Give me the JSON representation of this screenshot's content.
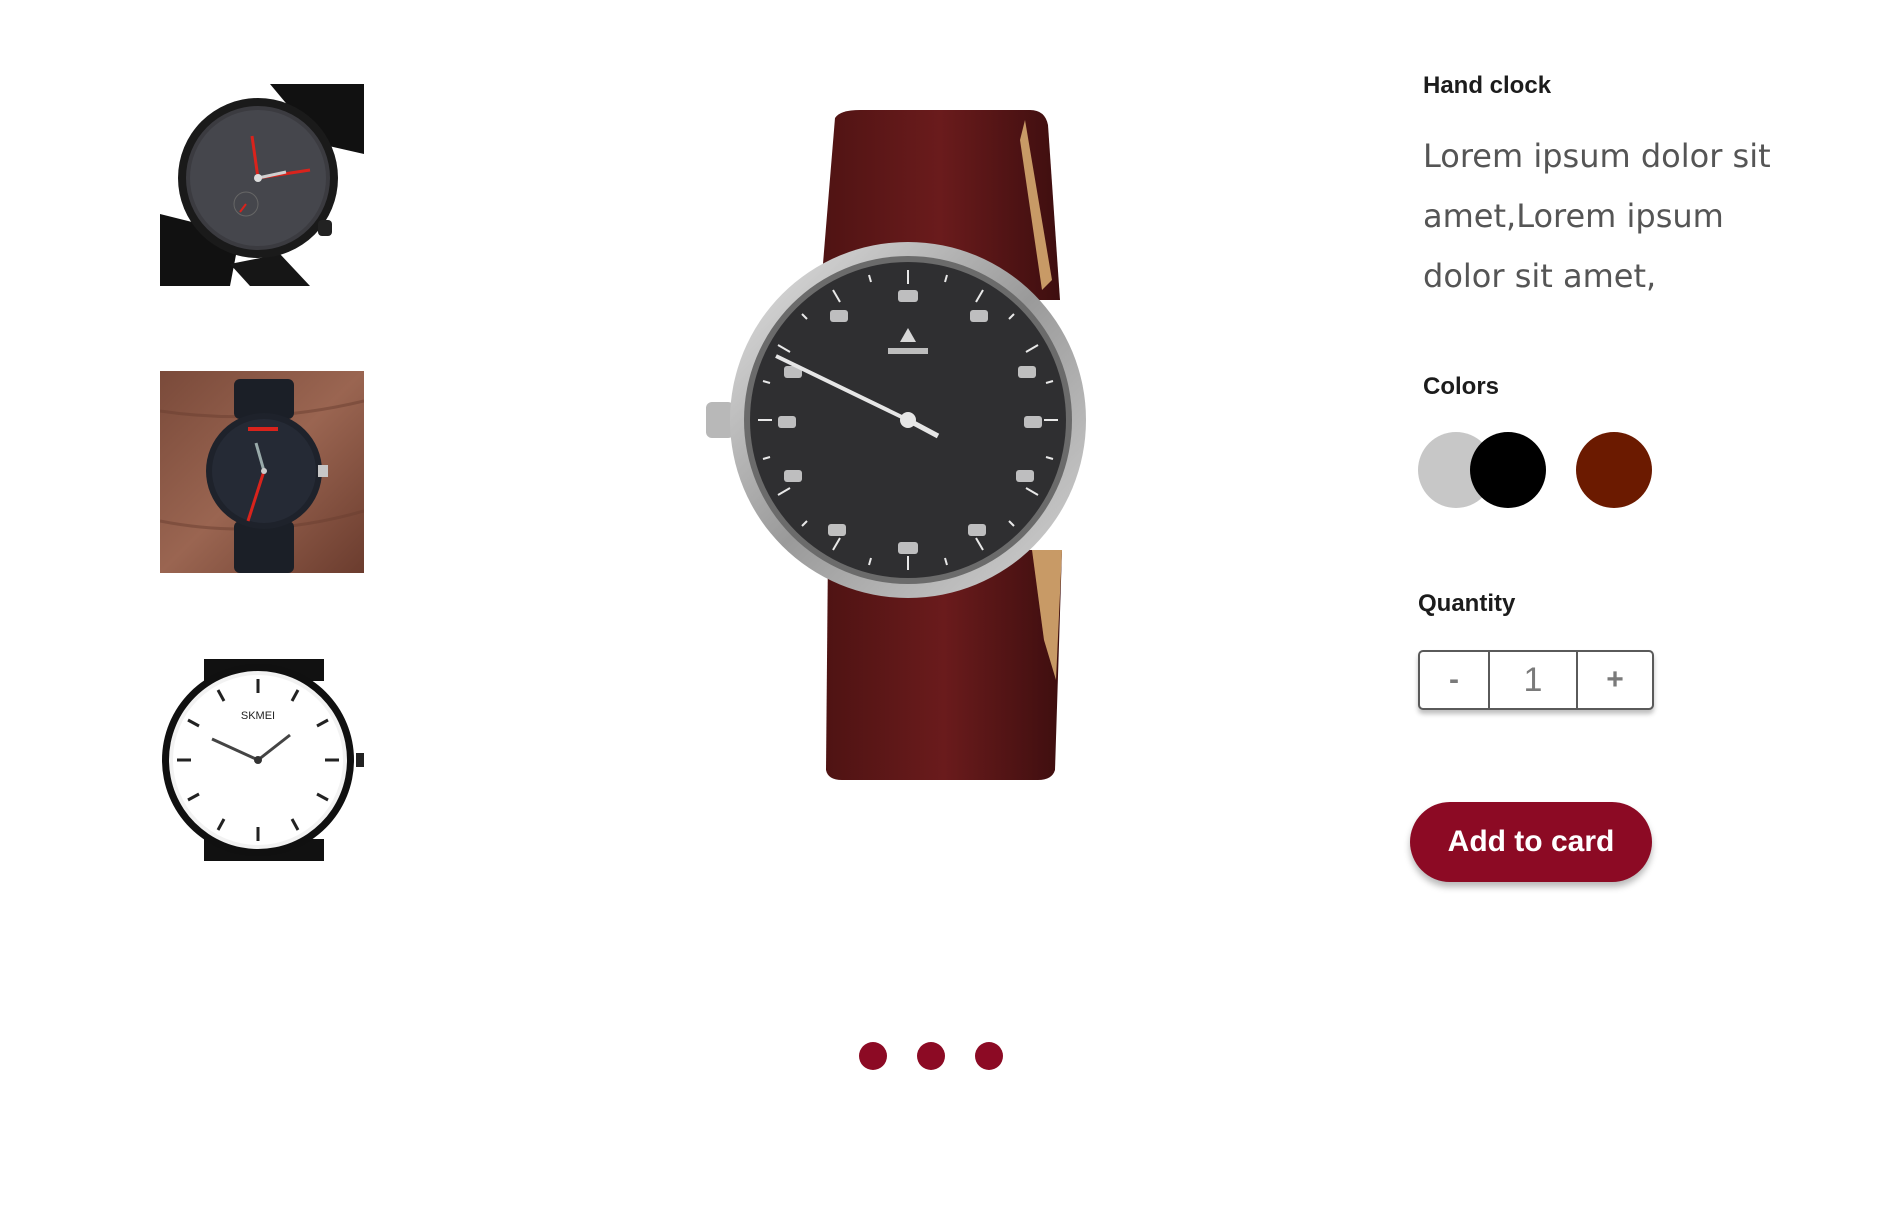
{
  "product": {
    "title": "Hand clock",
    "description": "Lorem ipsum dolor sit amet,Lorem ipsum dolor sit amet,"
  },
  "colors": {
    "label": "Colors",
    "options": [
      {
        "name": "silver",
        "hex": "#c7c7c7"
      },
      {
        "name": "black",
        "hex": "#000000"
      },
      {
        "name": "brown",
        "hex": "#6b1a00"
      }
    ]
  },
  "quantity": {
    "label": "Quantity",
    "decrement": "-",
    "value": "1",
    "increment": "+"
  },
  "add_button": {
    "label": "Add to card",
    "color": "#8c0a24"
  },
  "thumbnails": [
    {
      "name": "dark-grey-watch-red-hands"
    },
    {
      "name": "black-watch-on-wood"
    },
    {
      "name": "white-dial-skmei-watch",
      "brand_text": "SKMEI"
    }
  ],
  "main_image": {
    "name": "single-hand-watch-brown-strap"
  },
  "pagination": {
    "count": 3,
    "active_color": "#8c0a24"
  }
}
